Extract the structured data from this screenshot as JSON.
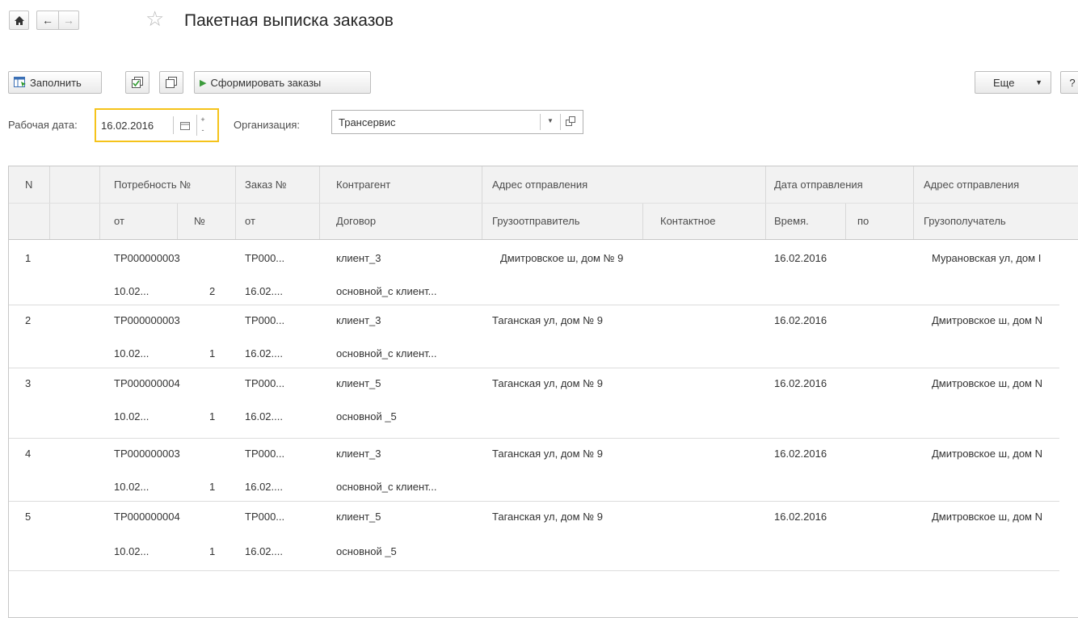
{
  "window": {
    "title": "Пакетная выписка заказов",
    "home_icon": "home-icon",
    "back_icon": "arrow-left-icon",
    "forward_icon": "arrow-right-icon",
    "favorite_icon": "star-icon"
  },
  "toolbar": {
    "fill_label": "Заполнить",
    "form_orders_label": "Сформировать заказы",
    "more_label": "Еще",
    "help_label": "?",
    "fill_icon": "fill-table-icon",
    "copy_icon_1": "select-all-icon",
    "copy_icon_2": "copy-icon",
    "play_icon": "play-icon"
  },
  "filters": {
    "work_date_label": "Рабочая дата:",
    "work_date_value": "16.02.2016",
    "org_label": "Организация:",
    "org_value": "Трансервис"
  },
  "table": {
    "headers_top": {
      "n": "N",
      "need": "Потребность №",
      "order": "Заказ №",
      "counterparty": "Контрагент",
      "ship_address": "Адрес отправления",
      "ship_date": "Дата отправления",
      "dest_address": "Адрес отправления"
    },
    "headers_bottom": {
      "need_from": "от",
      "need_no": "№",
      "order_from": "от",
      "contract": "Договор",
      "shipper": "Грузоотправитель",
      "contact": "Контактное",
      "time": "Время.",
      "to": "по",
      "consignee": "Грузополучатель"
    },
    "rows": [
      {
        "n": "1",
        "need": "ТР000000003",
        "order": "ТР000...",
        "counterparty": "клиент_3",
        "ship_address": "Дмитровское ш, дом № 9",
        "ship_date": "16.02.2016",
        "dest_address": "Мурановская ул, дом I",
        "need_date": "10.02...",
        "need_no": "2",
        "order_date": "16.02....",
        "contract": "основной_с клиент..."
      },
      {
        "n": "2",
        "need": "ТР000000003",
        "order": "ТР000...",
        "counterparty": "клиент_3",
        "ship_address": "Таганская ул, дом № 9",
        "ship_date": "16.02.2016",
        "dest_address": "Дмитровское ш, дом N",
        "need_date": "10.02...",
        "need_no": "1",
        "order_date": "16.02....",
        "contract": "основной_с клиент..."
      },
      {
        "n": "3",
        "need": "ТР000000004",
        "order": "ТР000...",
        "counterparty": "клиент_5",
        "ship_address": "Таганская ул, дом № 9",
        "ship_date": "16.02.2016",
        "dest_address": "Дмитровское ш, дом N",
        "need_date": "10.02...",
        "need_no": "1",
        "order_date": "16.02....",
        "contract": "основной _5"
      },
      {
        "n": "4",
        "need": "ТР000000003",
        "order": "ТР000...",
        "counterparty": "клиент_3",
        "ship_address": "Таганская ул, дом № 9",
        "ship_date": "16.02.2016",
        "dest_address": "Дмитровское ш, дом N",
        "need_date": "10.02...",
        "need_no": "1",
        "order_date": "16.02....",
        "contract": "основной_с клиент..."
      },
      {
        "n": "5",
        "need": "ТР000000004",
        "order": "ТР000...",
        "counterparty": "клиент_5",
        "ship_address": "Таганская ул, дом № 9",
        "ship_date": "16.02.2016",
        "dest_address": "Дмитровское ш, дом N",
        "need_date": "10.02...",
        "need_no": "1",
        "order_date": "16.02....",
        "contract": "основной _5"
      }
    ]
  },
  "colors": {
    "accent_focus": "#f5c31a",
    "header_bg": "#f2f2f2",
    "play_green": "#3a9a3a"
  }
}
